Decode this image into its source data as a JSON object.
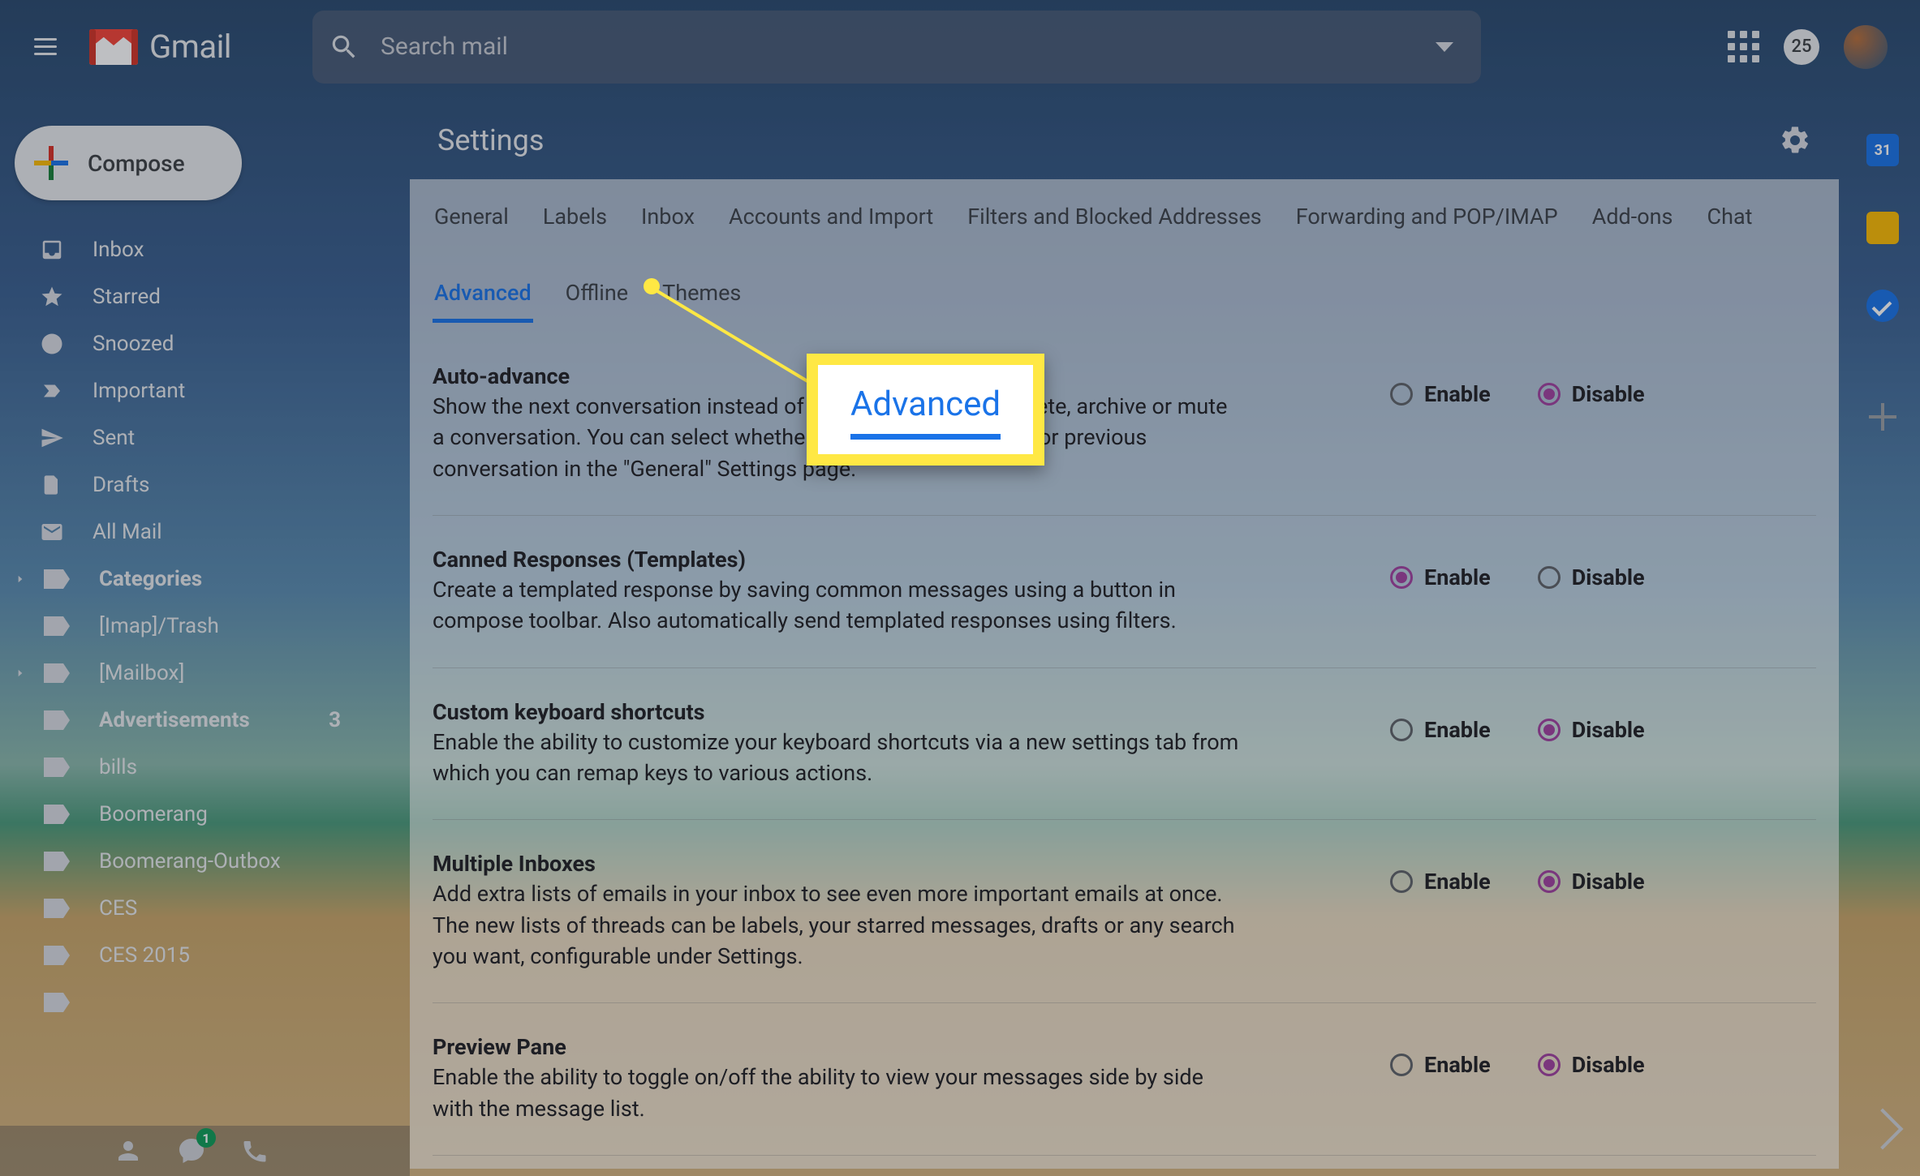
{
  "header": {
    "logo_text": "Gmail",
    "search_placeholder": "Search mail",
    "notif_count": "25"
  },
  "sidebar": {
    "compose_label": "Compose",
    "items": [
      {
        "label": "Inbox",
        "icon": "inbox"
      },
      {
        "label": "Starred",
        "icon": "star"
      },
      {
        "label": "Snoozed",
        "icon": "clock"
      },
      {
        "label": "Important",
        "icon": "important"
      },
      {
        "label": "Sent",
        "icon": "send"
      },
      {
        "label": "Drafts",
        "icon": "file"
      },
      {
        "label": "All Mail",
        "icon": "mail"
      },
      {
        "label": "Categories",
        "icon": "label",
        "bold": true,
        "chevron": true
      },
      {
        "label": "[Imap]/Trash",
        "icon": "label"
      },
      {
        "label": "[Mailbox]",
        "icon": "label",
        "chevron": true
      },
      {
        "label": "Advertisements",
        "icon": "label",
        "bold": true,
        "count": "3"
      },
      {
        "label": "bills",
        "icon": "label"
      },
      {
        "label": "Boomerang",
        "icon": "label"
      },
      {
        "label": "Boomerang-Outbox",
        "icon": "label"
      },
      {
        "label": "CES",
        "icon": "label"
      },
      {
        "label": "CES 2015",
        "icon": "label"
      },
      {
        "label": "",
        "icon": "label"
      }
    ],
    "hangouts_badge": "1"
  },
  "right_bar": {
    "calendar_day": "31"
  },
  "settings": {
    "title": "Settings",
    "tabs": [
      "General",
      "Labels",
      "Inbox",
      "Accounts and Import",
      "Filters and Blocked Addresses",
      "Forwarding and POP/IMAP",
      "Add-ons",
      "Chat",
      "Advanced",
      "Offline",
      "Themes"
    ],
    "active_tab": "Advanced",
    "enable_label": "Enable",
    "disable_label": "Disable",
    "rows": [
      {
        "title": "Auto-advance",
        "desc": "Show the next conversation instead of your inbox after you delete, archive or mute a conversation. You can select whether to advance to the next or previous conversation in the \"General\" Settings page.",
        "selected": "disable"
      },
      {
        "title": "Canned Responses (Templates)",
        "desc": "Create a templated response by saving common messages using a button in compose toolbar. Also automatically send templated responses using filters.",
        "selected": "enable"
      },
      {
        "title": "Custom keyboard shortcuts",
        "desc": "Enable the ability to customize your keyboard shortcuts via a new settings tab from which you can remap keys to various actions.",
        "selected": "disable"
      },
      {
        "title": "Multiple Inboxes",
        "desc": "Add extra lists of emails in your inbox to see even more important emails at once. The new lists of threads can be labels, your starred messages, drafts or any search you want, configurable under Settings.",
        "selected": "disable"
      },
      {
        "title": "Preview Pane",
        "desc": "Enable the ability to toggle on/off the ability to view your messages side by side with the message list.",
        "selected": "disable"
      }
    ]
  },
  "callout": {
    "text": "Advanced"
  }
}
